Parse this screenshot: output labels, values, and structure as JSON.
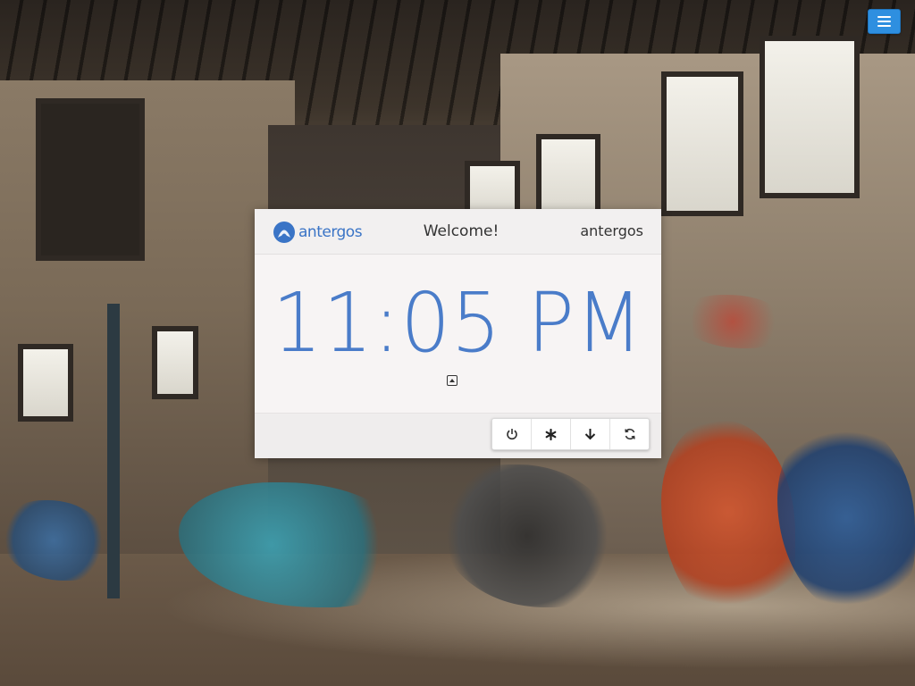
{
  "menu": {
    "icon": "hamburger-icon"
  },
  "greeter": {
    "logo_text": "antergos",
    "welcome": "Welcome!",
    "user": "antergos",
    "time": "11:05 PM",
    "toggle_icon": "caret-up-icon"
  },
  "actions": [
    {
      "name": "shutdown",
      "icon": "power-icon",
      "glyph": "⏻"
    },
    {
      "name": "suspend",
      "icon": "asterisk-icon",
      "glyph": "✱"
    },
    {
      "name": "hibernate",
      "icon": "arrow-down-icon",
      "glyph": "↓"
    },
    {
      "name": "restart",
      "icon": "refresh-icon",
      "glyph": "⟳"
    }
  ],
  "colors": {
    "accent": "#4a7cc9",
    "menu_button": "#2e8fe0"
  }
}
